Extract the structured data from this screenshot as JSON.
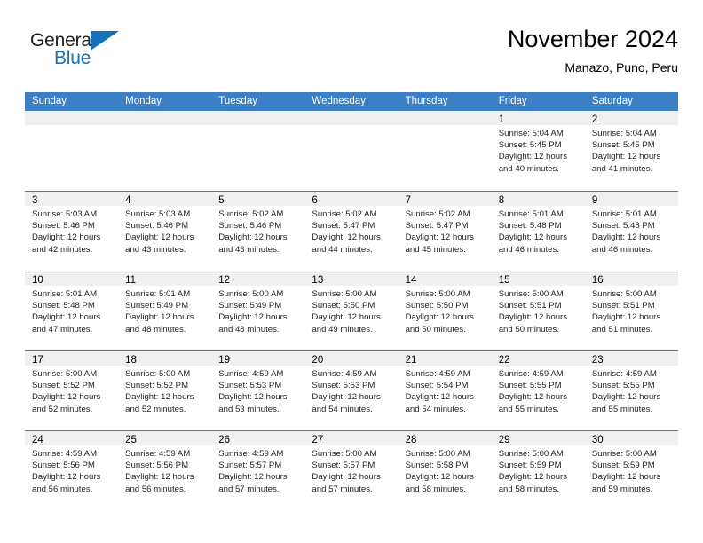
{
  "logo": {
    "word_one": "General",
    "word_two": "Blue",
    "triangle_icon": "triangle-icon",
    "color_blue": "#1573b9",
    "color_dark": "#231f20"
  },
  "header": {
    "title": "November 2024",
    "subtitle": "Manazo, Puno, Peru"
  },
  "calendar": {
    "accent_color": "#3b7fc4",
    "day_band_color": "#f0f0f0",
    "weekdays": [
      "Sunday",
      "Monday",
      "Tuesday",
      "Wednesday",
      "Thursday",
      "Friday",
      "Saturday"
    ],
    "weeks": [
      [
        {
          "day": "",
          "empty": true,
          "sunrise": "",
          "sunset": "",
          "daylight_a": "",
          "daylight_b": ""
        },
        {
          "day": "",
          "empty": true,
          "sunrise": "",
          "sunset": "",
          "daylight_a": "",
          "daylight_b": ""
        },
        {
          "day": "",
          "empty": true,
          "sunrise": "",
          "sunset": "",
          "daylight_a": "",
          "daylight_b": ""
        },
        {
          "day": "",
          "empty": true,
          "sunrise": "",
          "sunset": "",
          "daylight_a": "",
          "daylight_b": ""
        },
        {
          "day": "",
          "empty": true,
          "sunrise": "",
          "sunset": "",
          "daylight_a": "",
          "daylight_b": ""
        },
        {
          "day": "1",
          "empty": false,
          "sunrise": "Sunrise: 5:04 AM",
          "sunset": "Sunset: 5:45 PM",
          "daylight_a": "Daylight: 12 hours",
          "daylight_b": "and 40 minutes."
        },
        {
          "day": "2",
          "empty": false,
          "sunrise": "Sunrise: 5:04 AM",
          "sunset": "Sunset: 5:45 PM",
          "daylight_a": "Daylight: 12 hours",
          "daylight_b": "and 41 minutes."
        }
      ],
      [
        {
          "day": "3",
          "empty": false,
          "sunrise": "Sunrise: 5:03 AM",
          "sunset": "Sunset: 5:46 PM",
          "daylight_a": "Daylight: 12 hours",
          "daylight_b": "and 42 minutes."
        },
        {
          "day": "4",
          "empty": false,
          "sunrise": "Sunrise: 5:03 AM",
          "sunset": "Sunset: 5:46 PM",
          "daylight_a": "Daylight: 12 hours",
          "daylight_b": "and 43 minutes."
        },
        {
          "day": "5",
          "empty": false,
          "sunrise": "Sunrise: 5:02 AM",
          "sunset": "Sunset: 5:46 PM",
          "daylight_a": "Daylight: 12 hours",
          "daylight_b": "and 43 minutes."
        },
        {
          "day": "6",
          "empty": false,
          "sunrise": "Sunrise: 5:02 AM",
          "sunset": "Sunset: 5:47 PM",
          "daylight_a": "Daylight: 12 hours",
          "daylight_b": "and 44 minutes."
        },
        {
          "day": "7",
          "empty": false,
          "sunrise": "Sunrise: 5:02 AM",
          "sunset": "Sunset: 5:47 PM",
          "daylight_a": "Daylight: 12 hours",
          "daylight_b": "and 45 minutes."
        },
        {
          "day": "8",
          "empty": false,
          "sunrise": "Sunrise: 5:01 AM",
          "sunset": "Sunset: 5:48 PM",
          "daylight_a": "Daylight: 12 hours",
          "daylight_b": "and 46 minutes."
        },
        {
          "day": "9",
          "empty": false,
          "sunrise": "Sunrise: 5:01 AM",
          "sunset": "Sunset: 5:48 PM",
          "daylight_a": "Daylight: 12 hours",
          "daylight_b": "and 46 minutes."
        }
      ],
      [
        {
          "day": "10",
          "empty": false,
          "sunrise": "Sunrise: 5:01 AM",
          "sunset": "Sunset: 5:48 PM",
          "daylight_a": "Daylight: 12 hours",
          "daylight_b": "and 47 minutes."
        },
        {
          "day": "11",
          "empty": false,
          "sunrise": "Sunrise: 5:01 AM",
          "sunset": "Sunset: 5:49 PM",
          "daylight_a": "Daylight: 12 hours",
          "daylight_b": "and 48 minutes."
        },
        {
          "day": "12",
          "empty": false,
          "sunrise": "Sunrise: 5:00 AM",
          "sunset": "Sunset: 5:49 PM",
          "daylight_a": "Daylight: 12 hours",
          "daylight_b": "and 48 minutes."
        },
        {
          "day": "13",
          "empty": false,
          "sunrise": "Sunrise: 5:00 AM",
          "sunset": "Sunset: 5:50 PM",
          "daylight_a": "Daylight: 12 hours",
          "daylight_b": "and 49 minutes."
        },
        {
          "day": "14",
          "empty": false,
          "sunrise": "Sunrise: 5:00 AM",
          "sunset": "Sunset: 5:50 PM",
          "daylight_a": "Daylight: 12 hours",
          "daylight_b": "and 50 minutes."
        },
        {
          "day": "15",
          "empty": false,
          "sunrise": "Sunrise: 5:00 AM",
          "sunset": "Sunset: 5:51 PM",
          "daylight_a": "Daylight: 12 hours",
          "daylight_b": "and 50 minutes."
        },
        {
          "day": "16",
          "empty": false,
          "sunrise": "Sunrise: 5:00 AM",
          "sunset": "Sunset: 5:51 PM",
          "daylight_a": "Daylight: 12 hours",
          "daylight_b": "and 51 minutes."
        }
      ],
      [
        {
          "day": "17",
          "empty": false,
          "sunrise": "Sunrise: 5:00 AM",
          "sunset": "Sunset: 5:52 PM",
          "daylight_a": "Daylight: 12 hours",
          "daylight_b": "and 52 minutes."
        },
        {
          "day": "18",
          "empty": false,
          "sunrise": "Sunrise: 5:00 AM",
          "sunset": "Sunset: 5:52 PM",
          "daylight_a": "Daylight: 12 hours",
          "daylight_b": "and 52 minutes."
        },
        {
          "day": "19",
          "empty": false,
          "sunrise": "Sunrise: 4:59 AM",
          "sunset": "Sunset: 5:53 PM",
          "daylight_a": "Daylight: 12 hours",
          "daylight_b": "and 53 minutes."
        },
        {
          "day": "20",
          "empty": false,
          "sunrise": "Sunrise: 4:59 AM",
          "sunset": "Sunset: 5:53 PM",
          "daylight_a": "Daylight: 12 hours",
          "daylight_b": "and 54 minutes."
        },
        {
          "day": "21",
          "empty": false,
          "sunrise": "Sunrise: 4:59 AM",
          "sunset": "Sunset: 5:54 PM",
          "daylight_a": "Daylight: 12 hours",
          "daylight_b": "and 54 minutes."
        },
        {
          "day": "22",
          "empty": false,
          "sunrise": "Sunrise: 4:59 AM",
          "sunset": "Sunset: 5:55 PM",
          "daylight_a": "Daylight: 12 hours",
          "daylight_b": "and 55 minutes."
        },
        {
          "day": "23",
          "empty": false,
          "sunrise": "Sunrise: 4:59 AM",
          "sunset": "Sunset: 5:55 PM",
          "daylight_a": "Daylight: 12 hours",
          "daylight_b": "and 55 minutes."
        }
      ],
      [
        {
          "day": "24",
          "empty": false,
          "sunrise": "Sunrise: 4:59 AM",
          "sunset": "Sunset: 5:56 PM",
          "daylight_a": "Daylight: 12 hours",
          "daylight_b": "and 56 minutes."
        },
        {
          "day": "25",
          "empty": false,
          "sunrise": "Sunrise: 4:59 AM",
          "sunset": "Sunset: 5:56 PM",
          "daylight_a": "Daylight: 12 hours",
          "daylight_b": "and 56 minutes."
        },
        {
          "day": "26",
          "empty": false,
          "sunrise": "Sunrise: 4:59 AM",
          "sunset": "Sunset: 5:57 PM",
          "daylight_a": "Daylight: 12 hours",
          "daylight_b": "and 57 minutes."
        },
        {
          "day": "27",
          "empty": false,
          "sunrise": "Sunrise: 5:00 AM",
          "sunset": "Sunset: 5:57 PM",
          "daylight_a": "Daylight: 12 hours",
          "daylight_b": "and 57 minutes."
        },
        {
          "day": "28",
          "empty": false,
          "sunrise": "Sunrise: 5:00 AM",
          "sunset": "Sunset: 5:58 PM",
          "daylight_a": "Daylight: 12 hours",
          "daylight_b": "and 58 minutes."
        },
        {
          "day": "29",
          "empty": false,
          "sunrise": "Sunrise: 5:00 AM",
          "sunset": "Sunset: 5:59 PM",
          "daylight_a": "Daylight: 12 hours",
          "daylight_b": "and 58 minutes."
        },
        {
          "day": "30",
          "empty": false,
          "sunrise": "Sunrise: 5:00 AM",
          "sunset": "Sunset: 5:59 PM",
          "daylight_a": "Daylight: 12 hours",
          "daylight_b": "and 59 minutes."
        }
      ]
    ]
  }
}
